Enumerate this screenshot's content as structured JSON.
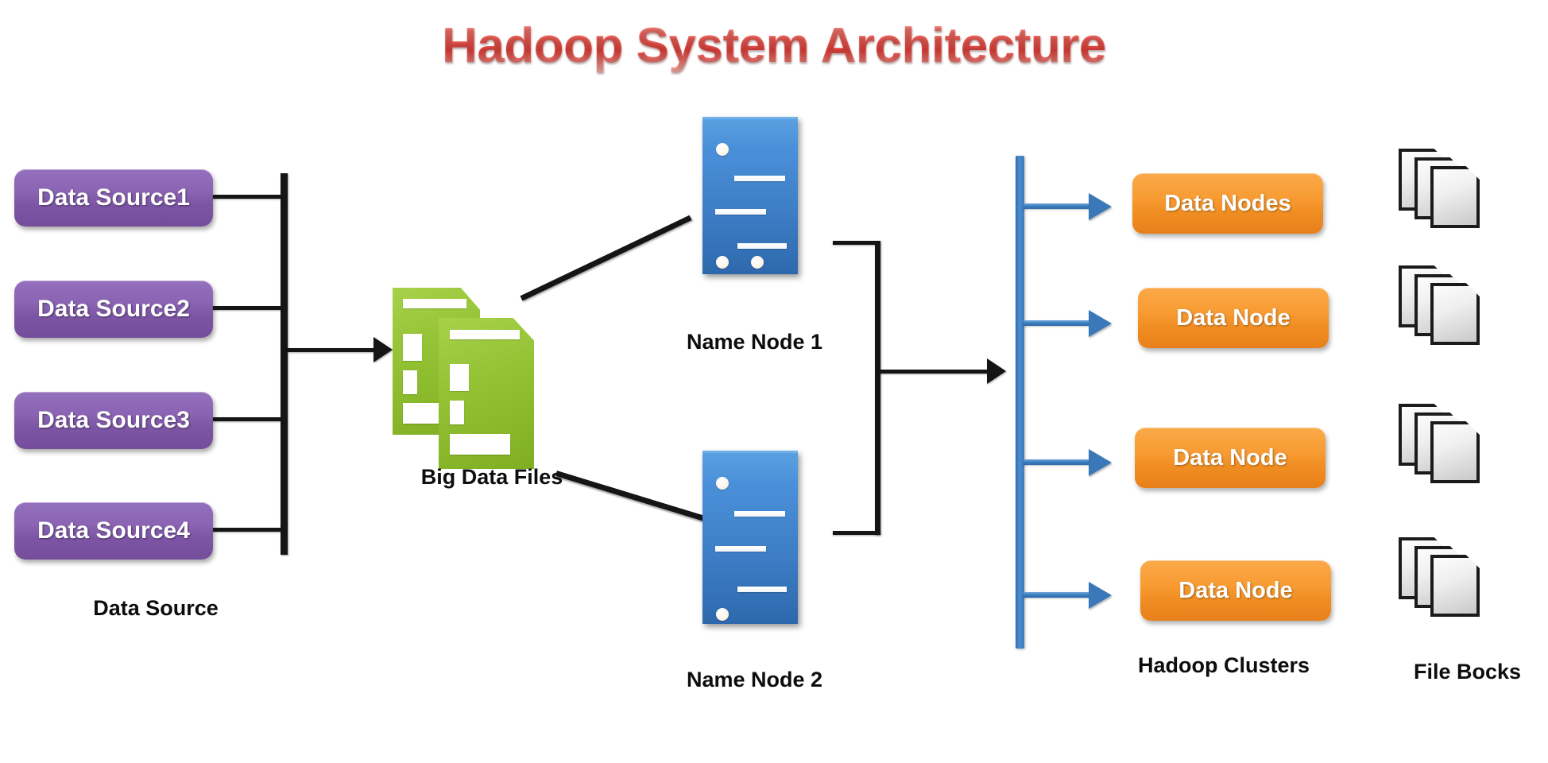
{
  "diagram": {
    "title": "Hadoop System Architecture",
    "title_color": "#e8423c",
    "background": "#ffffff"
  },
  "data_sources": {
    "group_label": "Data Source",
    "box_color": "#8058A8",
    "items": [
      {
        "label": "Data Source1"
      },
      {
        "label": "Data Source2"
      },
      {
        "label": "Data Source3"
      },
      {
        "label": "Data Source4"
      }
    ]
  },
  "big_data_files": {
    "label": "Big Data Files",
    "icon": "green-documents-icon",
    "color": "#93C234"
  },
  "name_nodes": [
    {
      "label": "Name Node 1",
      "icon": "server-icon",
      "color": "#4A90D9"
    },
    {
      "label": "Name Node 2",
      "icon": "server-icon",
      "color": "#4A90D9"
    }
  ],
  "hadoop_clusters": {
    "group_label": "Hadoop Clusters",
    "bus_color": "#3D7CBE",
    "box_color": "#F89C33",
    "nodes": [
      {
        "label": "Data Nodes"
      },
      {
        "label": "Data Node"
      },
      {
        "label": "Data Node"
      },
      {
        "label": "Data Node"
      }
    ]
  },
  "file_blocks": {
    "group_label": "File Bocks",
    "icon": "file-stack-icon",
    "color": "#D9D9D9",
    "stacks": 4,
    "sheets_per_stack": 3
  }
}
